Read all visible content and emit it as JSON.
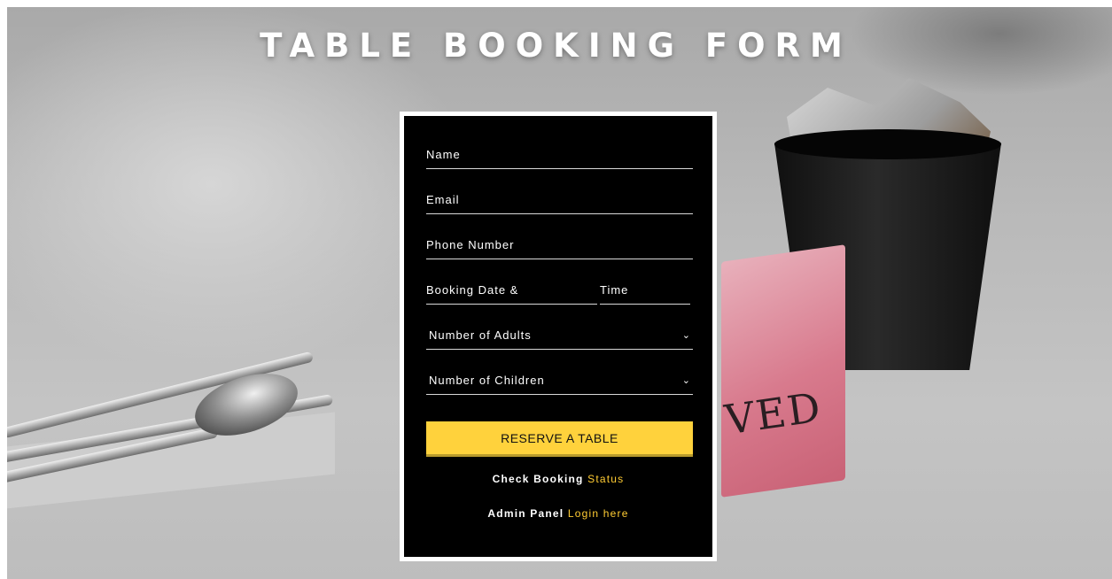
{
  "page": {
    "title": "TABLE BOOKING FORM"
  },
  "form": {
    "fields": {
      "name": "Name",
      "email": "Email",
      "phone": "Phone Number",
      "booking_date": "Booking Date &",
      "time": "Time",
      "adults": "Number of Adults",
      "children": "Number of Children"
    },
    "reserve_label": "RESERVE A TABLE",
    "check_status": {
      "prefix": "Check Booking",
      "link": "Status"
    },
    "admin": {
      "prefix": "Admin Panel",
      "link": "Login here"
    }
  },
  "background": {
    "sign_text": "VED"
  },
  "colors": {
    "accent": "#ffd23c",
    "link": "#ffcc33",
    "card": "#000000"
  },
  "icons": {
    "select_chevron": "chevron-down-icon"
  }
}
